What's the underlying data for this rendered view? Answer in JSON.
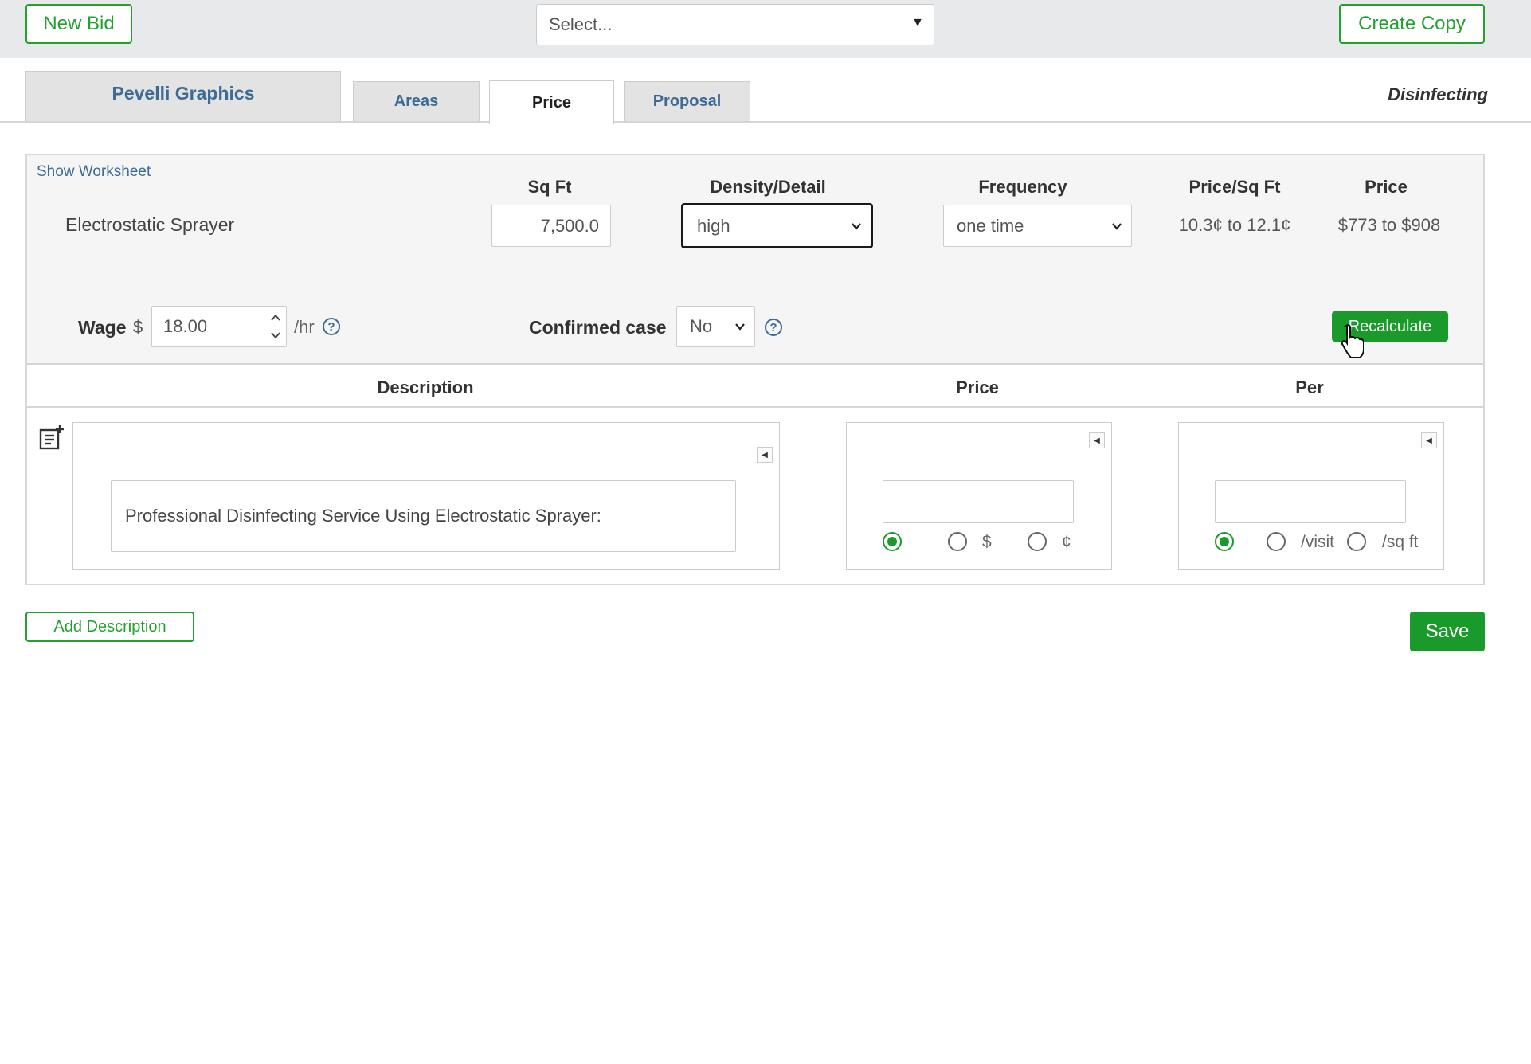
{
  "toolbar": {
    "new_bid_label": "New Bid",
    "select_placeholder": "Select...",
    "create_copy_label": "Create Copy"
  },
  "tabs": {
    "company": "Pevelli Graphics",
    "areas": "Areas",
    "price": "Price",
    "proposal": "Proposal",
    "active": "Price"
  },
  "service_name": "Disinfecting",
  "worksheet": {
    "show_worksheet_label": "Show Worksheet",
    "headers": {
      "sqft": "Sq Ft",
      "density": "Density/Detail",
      "frequency": "Frequency",
      "price_per_sqft": "Price/Sq Ft",
      "price": "Price"
    },
    "row": {
      "label": "Electrostatic Sprayer",
      "sqft": "7,500.0",
      "density": "high",
      "frequency": "one time",
      "price_per_sqft": "10.3¢ to 12.1¢",
      "price": "$773 to $908"
    },
    "wage_label": "Wage",
    "wage_currency": "$",
    "wage_value": "18.00",
    "wage_unit": "/hr",
    "confirmed_case_label": "Confirmed case",
    "confirmed_case_value": "No",
    "recalculate_label": "Recalculate"
  },
  "description_table": {
    "headers": {
      "description": "Description",
      "price": "Price",
      "per": "Per"
    },
    "rows": [
      {
        "description": "Professional Disinfecting Service Using Electrostatic Sprayer:",
        "price_value": "",
        "price_options": [
          "",
          "$",
          "¢"
        ],
        "price_selected": 0,
        "per_value": "",
        "per_options": [
          "",
          "/visit",
          "/sq ft"
        ],
        "per_selected": 0
      }
    ]
  },
  "actions": {
    "add_description_label": "Add Description",
    "save_label": "Save"
  },
  "colors": {
    "accent_green": "#1a9a2a",
    "link_blue": "#3d6b95"
  }
}
